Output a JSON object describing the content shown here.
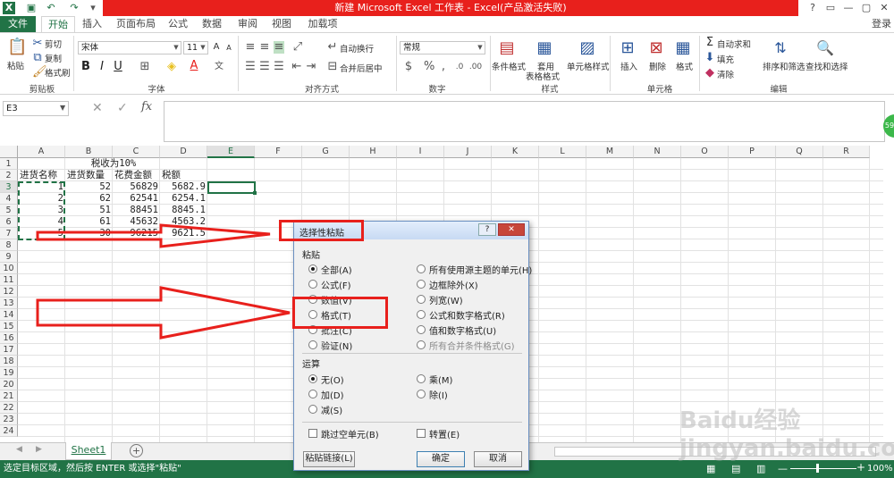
{
  "window": {
    "title": "新建 Microsoft Excel 工作表 - Excel(产品激活失败)",
    "login": "登录"
  },
  "tabs": [
    "文件",
    "开始",
    "插入",
    "页面布局",
    "公式",
    "数据",
    "审阅",
    "视图",
    "加载项"
  ],
  "ribbon": {
    "clipboard": {
      "paste": "粘贴",
      "cut": "剪切",
      "copy": "复制",
      "format_painter": "格式刷",
      "group": "剪贴板"
    },
    "font": {
      "name": "宋体",
      "size": "11",
      "bold": "B",
      "italic": "I",
      "underline": "U",
      "group": "字体"
    },
    "alignment": {
      "wrap": "自动换行",
      "merge": "合并后居中",
      "group": "对齐方式"
    },
    "number": {
      "format": "常规",
      "group": "数字"
    },
    "styles": {
      "conditional": "条件格式",
      "table_format_1": "套用",
      "table_format_2": "表格格式",
      "cell_styles": "单元格样式",
      "group": "样式"
    },
    "cells": {
      "insert": "插入",
      "delete": "删除",
      "format": "格式",
      "group": "单元格"
    },
    "editing": {
      "autosum": "自动求和",
      "fill": "填充",
      "clear": "清除",
      "sort": "排序和筛选",
      "find": "查找和选择",
      "group": "编辑"
    }
  },
  "formula_bar": {
    "name_box": "E3",
    "fx": "fx"
  },
  "columns": [
    "A",
    "B",
    "C",
    "D",
    "E",
    "F",
    "G",
    "H",
    "I",
    "J",
    "K",
    "L",
    "M",
    "N",
    "O",
    "P",
    "Q",
    "R"
  ],
  "rows": [
    "1",
    "2",
    "3",
    "4",
    "5",
    "6",
    "7",
    "8",
    "9",
    "10",
    "11",
    "12",
    "13",
    "14",
    "15",
    "16",
    "17",
    "18",
    "19",
    "20",
    "21",
    "22",
    "23",
    "24"
  ],
  "cells": {
    "r1": {
      "B": "税收为10%"
    },
    "r2": {
      "A": "进货名称",
      "B": "进货数量",
      "C": "花费金额",
      "D": "税额"
    },
    "data": [
      {
        "A": "1",
        "B": "52",
        "C": "56829",
        "D": "5682.9"
      },
      {
        "A": "2",
        "B": "62",
        "C": "62541",
        "D": "6254.1"
      },
      {
        "A": "3",
        "B": "51",
        "C": "88451",
        "D": "8845.1"
      },
      {
        "A": "4",
        "B": "61",
        "C": "45632",
        "D": "4563.2"
      },
      {
        "A": "5",
        "B": "30",
        "C": "96215",
        "D": "9621.5"
      }
    ]
  },
  "sheet": {
    "tab": "Sheet1",
    "add": "+"
  },
  "status": {
    "text": "选定目标区域，然后按 ENTER 或选择\"粘贴\"",
    "zoom": "100%"
  },
  "dialog": {
    "title": "选择性粘贴",
    "help": "?",
    "close": "✕",
    "paste_section": "粘贴",
    "paste_left": [
      "全部(A)",
      "公式(F)",
      "数值(V)",
      "格式(T)",
      "批注(C)",
      "验证(N)"
    ],
    "paste_right": [
      "所有使用源主题的单元(H)",
      "边框除外(X)",
      "列宽(W)",
      "公式和数字格式(R)",
      "值和数字格式(U)",
      "所有合并条件格式(G)"
    ],
    "op_section": "运算",
    "op_left": [
      "无(O)",
      "加(D)",
      "减(S)"
    ],
    "op_right": [
      "乘(M)",
      "除(I)"
    ],
    "skip_blanks": "跳过空单元(B)",
    "transpose": "转置(E)",
    "paste_link": "粘贴链接(L)",
    "ok": "确定",
    "cancel": "取消"
  },
  "watermark": "Baidu经验 jingyan.baidu.com",
  "side_badge": "59"
}
